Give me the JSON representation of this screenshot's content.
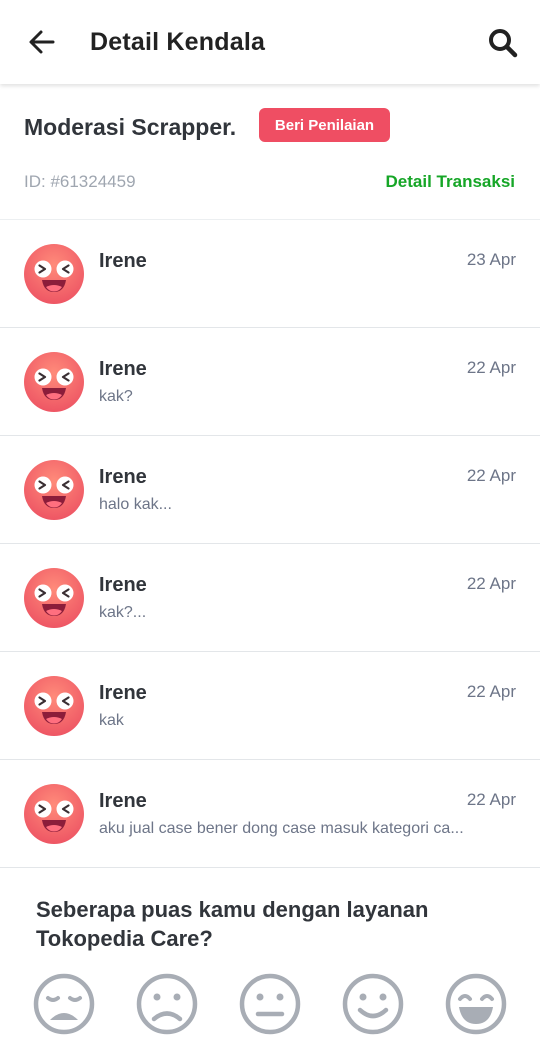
{
  "appbar": {
    "title": "Detail Kendala",
    "back_icon": "arrow-left-icon",
    "search_icon": "search-icon"
  },
  "case": {
    "title": "Moderasi Scrapper.",
    "rate_button": "Beri Penilaian",
    "id": "ID: #61324459",
    "detail_link": "Detail Transaksi"
  },
  "colors": {
    "accent_red": "#ef4e63",
    "link_green": "#16a627",
    "avatar_pink": "#f0606c"
  },
  "messages": [
    {
      "name": "Irene",
      "date": "23 Apr",
      "text": "",
      "avatar_icon": "laughing-emoji-avatar-icon"
    },
    {
      "name": "Irene",
      "date": "22 Apr",
      "text": "kak?",
      "avatar_icon": "laughing-emoji-avatar-icon"
    },
    {
      "name": "Irene",
      "date": "22 Apr",
      "text": "halo kak...",
      "avatar_icon": "laughing-emoji-avatar-icon"
    },
    {
      "name": "Irene",
      "date": "22 Apr",
      "text": "kak?...",
      "avatar_icon": "laughing-emoji-avatar-icon"
    },
    {
      "name": "Irene",
      "date": "22 Apr",
      "text": "kak",
      "avatar_icon": "laughing-emoji-avatar-icon"
    },
    {
      "name": "Irene",
      "date": "22 Apr",
      "text": "aku jual case bener dong case masuk kategori ca...",
      "avatar_icon": "laughing-emoji-avatar-icon"
    }
  ],
  "survey": {
    "question": "Seberapa puas kamu dengan layanan Tokopedia Care?",
    "faces": [
      "very-sad-face-icon",
      "sad-face-icon",
      "neutral-face-icon",
      "smile-face-icon",
      "very-happy-face-icon"
    ]
  }
}
